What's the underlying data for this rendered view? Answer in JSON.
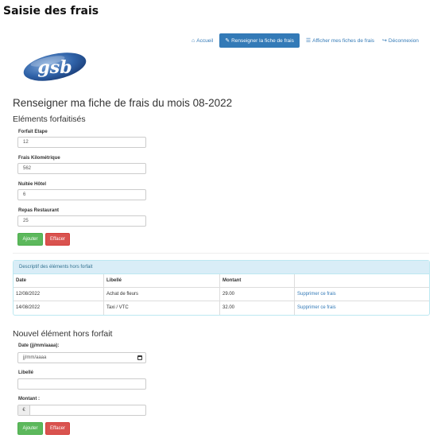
{
  "page": {
    "heading": "Saisie des frais"
  },
  "nav": {
    "items": [
      {
        "icon": "home-icon",
        "glyph": "⌂",
        "label": "Accueil"
      },
      {
        "icon": "pencil-icon",
        "glyph": "✎",
        "label": "Renseigner la fiche de frais",
        "active": true
      },
      {
        "icon": "list-icon",
        "glyph": "☰",
        "label": "Afficher mes fiches de frais"
      },
      {
        "icon": "logout-icon",
        "glyph": "↪",
        "label": "Déconnexion"
      }
    ]
  },
  "logo": {
    "text": "gsb"
  },
  "forfait": {
    "title": "Renseigner ma fiche de frais du mois 08-2022",
    "subtitle": "Eléments forfaitisés",
    "fields": [
      {
        "label": "Forfait Etape",
        "value": "12"
      },
      {
        "label": "Frais Kilométrique",
        "value": "562"
      },
      {
        "label": "Nuitée Hôtel",
        "value": "6"
      },
      {
        "label": "Repas Restaurant",
        "value": "25"
      }
    ],
    "submit_label": "Ajouter",
    "reset_label": "Effacer"
  },
  "horsforfait": {
    "panel_title": "Descriptif des éléments hors forfait",
    "columns": [
      "Date",
      "Libellé",
      "Montant",
      ""
    ],
    "rows": [
      {
        "date": "12/08/2022",
        "libelle": "Achat de fleurs",
        "montant": "29.00",
        "action": "Supprimer ce frais"
      },
      {
        "date": "14/08/2022",
        "libelle": "Taxi / VTC",
        "montant": "32.00",
        "action": "Supprimer ce frais"
      }
    ]
  },
  "nouvel": {
    "title": "Nouvel élément hors forfait",
    "date_label": "Date (jj/mm/aaaa):",
    "date_placeholder": "jj/mm/aaaa",
    "libelle_label": "Libellé",
    "libelle_value": "",
    "montant_label": "Montant :",
    "currency": "€",
    "montant_value": "",
    "submit_label": "Ajouter",
    "reset_label": "Effacer"
  },
  "colors": {
    "primary": "#337ab7",
    "success": "#5cb85c",
    "danger": "#d9534f",
    "info_bg": "#d9edf7"
  }
}
